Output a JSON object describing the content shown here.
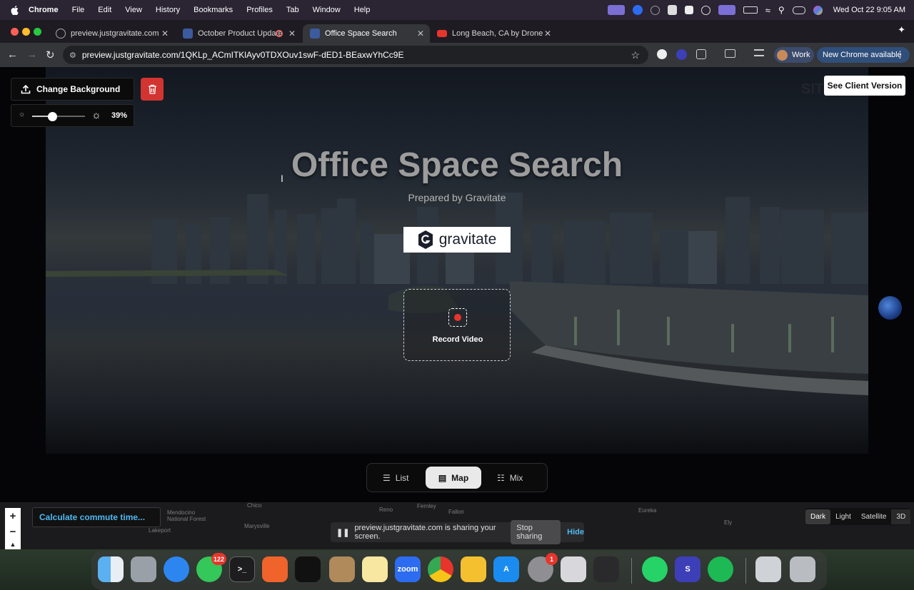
{
  "menubar": {
    "app_name": "Chrome",
    "items": [
      "File",
      "Edit",
      "View",
      "History",
      "Bookmarks",
      "Profiles",
      "Tab",
      "Window",
      "Help"
    ],
    "clock": "Wed Oct 22  9:05 AM"
  },
  "tabs": [
    {
      "title": "preview.justgravitate.com",
      "active": false
    },
    {
      "title": "October Product Update",
      "active": false
    },
    {
      "title": "Office Space Search",
      "active": true
    },
    {
      "title": "Long Beach, CA by Drone - Y",
      "active": false
    }
  ],
  "address_bar": {
    "url": "preview.justgravitate.com/1QKLp_ACmITKlAyv0TDXOuv1swF-dED1-BEaxwYhCc9E"
  },
  "toolbar": {
    "profile_label": "Work",
    "update_label": "New Chrome available"
  },
  "page": {
    "change_background_label": "Change Background",
    "brightness_value": 0.39,
    "brightness_label": "39%",
    "client_version_label": "See Client Version",
    "title": "Office Space Search",
    "subtitle": "Prepared by Gravitate",
    "logo_text": "gravitate",
    "record_label": "Record Video",
    "view_toggle": [
      {
        "label": "List",
        "icon": "list-icon",
        "active": false
      },
      {
        "label": "Map",
        "icon": "map-icon",
        "active": true
      },
      {
        "label": "Mix",
        "icon": "mix-icon",
        "active": false
      }
    ]
  },
  "map": {
    "commute_placeholder": "Calculate commute time...",
    "labels": [
      "Chico",
      "Mendocino National Forest",
      "Marysville",
      "Lakeport",
      "Reno",
      "Fernley",
      "Fallon",
      "Eureka",
      "Ely"
    ],
    "map_types": [
      {
        "label": "Dark",
        "active": true
      },
      {
        "label": "Light",
        "active": false
      },
      {
        "label": "Satellite",
        "active": false
      },
      {
        "label": "3D",
        "active": false
      }
    ]
  },
  "screen_share": {
    "message": "preview.justgravitate.com is sharing your screen.",
    "stop_label": "Stop sharing",
    "hide_label": "Hide"
  },
  "dock": {
    "messages_badge": "122",
    "app_store_badge": "1",
    "zoom_label": "zoom"
  },
  "colors": {
    "accent_blue": "#4fb8f2",
    "delete_red": "#d23431",
    "record_red": "#e8352c"
  }
}
